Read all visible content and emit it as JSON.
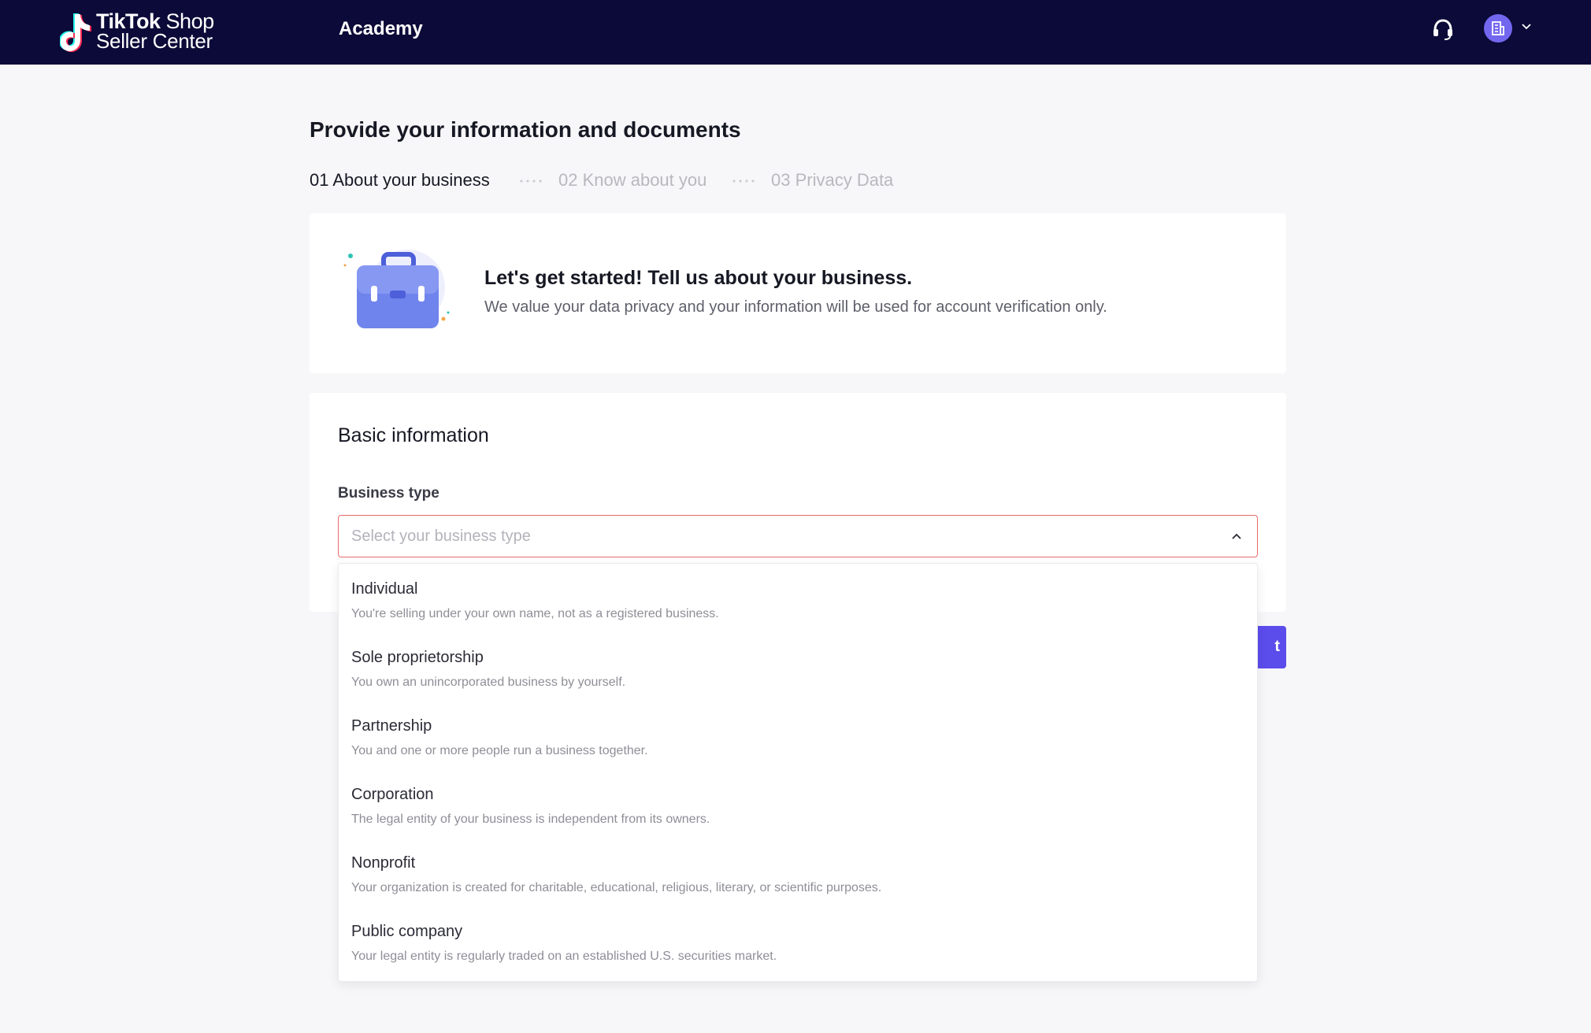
{
  "header": {
    "logo": {
      "brand": "TikTok",
      "product": "Shop",
      "subtitle": "Seller Center"
    },
    "nav": {
      "academy": "Academy"
    },
    "icons": {
      "support": "headset-icon",
      "account": "building-icon",
      "menu": "chevron-down-icon"
    }
  },
  "page": {
    "title": "Provide your information and documents"
  },
  "steps": [
    {
      "label": "01 About your business",
      "state": "active"
    },
    {
      "label": "02 Know about you",
      "state": "inactive"
    },
    {
      "label": "03 Privacy Data",
      "state": "inactive"
    }
  ],
  "intro": {
    "heading": "Let's get started! Tell us about your business.",
    "subtext": "We value your data privacy and your information will be used for account verification only.",
    "illustration": "briefcase-illustration"
  },
  "basic_info": {
    "title": "Basic information",
    "business_type": {
      "label": "Business type",
      "placeholder": "Select your business type",
      "expanded": true
    }
  },
  "next_button": {
    "label": "t"
  },
  "business_type_options": [
    {
      "title": "Individual",
      "description": "You're selling under your own name, not as a registered business."
    },
    {
      "title": "Sole proprietorship",
      "description": "You own an unincorporated business by yourself."
    },
    {
      "title": "Partnership",
      "description": "You and one or more people run a business together."
    },
    {
      "title": "Corporation",
      "description": "The legal entity of your business is independent from its owners."
    },
    {
      "title": "Nonprofit",
      "description": "Your organization is created for charitable, educational, religious, literary, or scientific purposes."
    },
    {
      "title": "Public company",
      "description": "Your legal entity is regularly traded on an established U.S. securities market."
    }
  ],
  "colors": {
    "header_bg": "#0b0a38",
    "primary": "#5b4cec",
    "avatar": "#7367f0",
    "error_border": "#e86a6a",
    "page_bg": "#f7f7f9"
  }
}
